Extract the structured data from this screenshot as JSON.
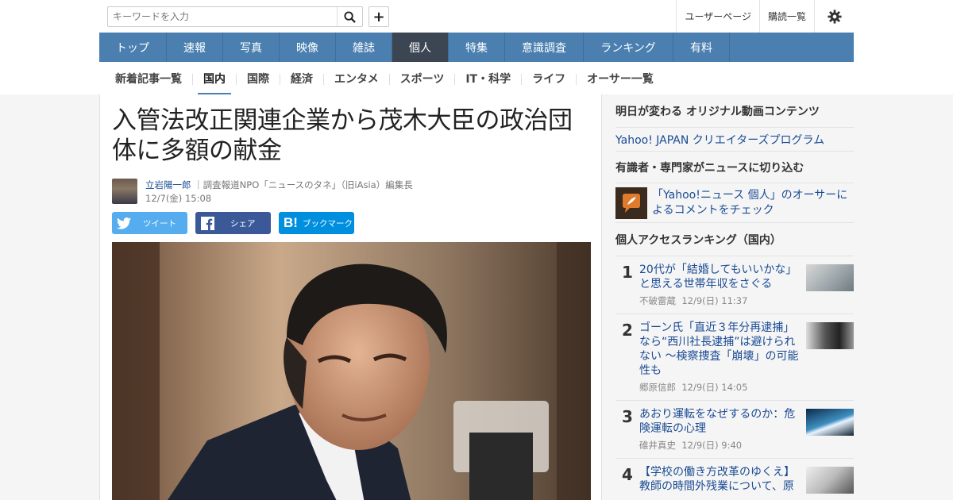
{
  "search": {
    "placeholder": "キーワードを入力"
  },
  "header": {
    "user_page": "ユーザーページ",
    "subscriptions": "購読一覧"
  },
  "nav": {
    "items": [
      "トップ",
      "速報",
      "写真",
      "映像",
      "雑誌",
      "個人",
      "特集",
      "意識調査",
      "ランキング",
      "有料"
    ],
    "active": "個人"
  },
  "subnav": {
    "items": [
      "新着記事一覧",
      "国内",
      "国際",
      "経済",
      "エンタメ",
      "スポーツ",
      "IT・科学",
      "ライフ",
      "オーサー一覧"
    ],
    "active": "国内"
  },
  "article": {
    "title": "入管法改正関連企業から茂木大臣の政治団体に多額の献金",
    "author": "立岩陽一郎",
    "author_title": "｜調査報道NPO「ニュースのタネ」（旧iAsia）編集長",
    "date": "12/7(金) 15:08",
    "share": {
      "tweet": "ツイート",
      "facebook": "シェア",
      "hatena": "ブックマーク"
    }
  },
  "sidebar": {
    "video_heading": "明日が変わる オリジナル動画コンテンツ",
    "video_link": "Yahoo! JAPAN クリエイターズプログラム",
    "expert_heading": "有識者・専門家がニュースに切り込む",
    "expert_link": "「Yahoo!ニュース 個人」のオーサーによるコメントをチェック",
    "ranking_heading": "個人アクセスランキング（国内）",
    "ranking": [
      {
        "rank": "1",
        "title": "20代が「結婚してもいいかな」と思える世帯年収をさぐる",
        "author": "不破雷蔵",
        "date": "12/9(日) 11:37"
      },
      {
        "rank": "2",
        "title": "ゴーン氏「直近３年分再逮捕」なら“西川社長逮捕”は避けられない ～検察捜査「崩壊」の可能性も",
        "author": "郷原信郎",
        "date": "12/9(日) 14:05"
      },
      {
        "rank": "3",
        "title": "あおり運転をなぜするのか：危険運転の心理",
        "author": "碓井真史",
        "date": "12/9(日) 9:40"
      },
      {
        "rank": "4",
        "title": "【学校の働き方改革のゆくえ】教師の時間外残業について、原",
        "author": "",
        "date": ""
      }
    ]
  },
  "colors": {
    "nav_bg": "#4a7fb0",
    "nav_active": "#3c4552",
    "link": "#1a4b94",
    "twitter": "#55acee",
    "facebook": "#3b5998",
    "hatena": "#008fde"
  }
}
